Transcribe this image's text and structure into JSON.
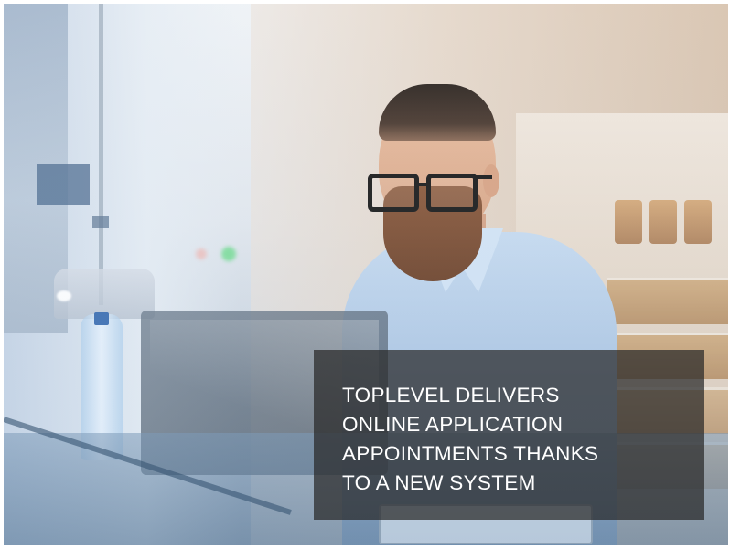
{
  "hero": {
    "headline_lines": [
      "TOPLEVEL DELIVERS",
      "ONLINE APPLICATION",
      "APPOINTMENTS THANKS",
      "TO A NEW SYSTEM"
    ]
  },
  "colors": {
    "card_background": "#282828",
    "headline_text": "#ffffff",
    "frame": "#ffffff"
  }
}
